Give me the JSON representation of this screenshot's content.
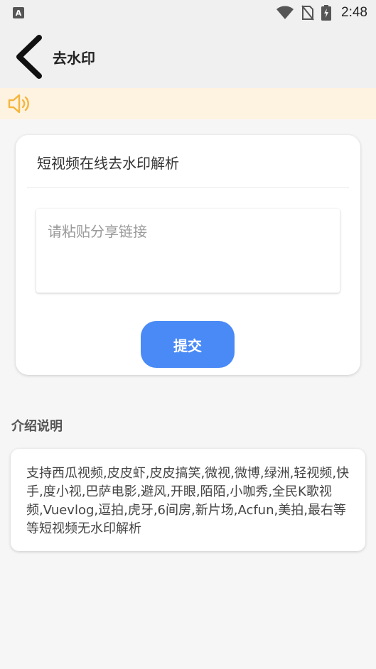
{
  "status_bar": {
    "app_badge": "A",
    "time": "2:48"
  },
  "app_bar": {
    "title": "去水印"
  },
  "card": {
    "title": "短视频在线去水印解析",
    "input_placeholder": "请粘贴分享链接",
    "input_value": "",
    "submit_label": "提交"
  },
  "intro": {
    "title": "介绍说明",
    "text": "支持西瓜视频,皮皮虾,皮皮搞笑,微视,微博,绿洲,轻视频,快手,度小视,巴萨电影,避风,开眼,陌陌,小咖秀,全民K歌视频,Vuevlog,逗拍,虎牙,6间房,新片场,Acfun,美拍,最右等等短视频无水印解析"
  },
  "colors": {
    "accent": "#4a8af6",
    "notice_bg": "#fef3e0",
    "notice_icon": "#f5b53c"
  }
}
